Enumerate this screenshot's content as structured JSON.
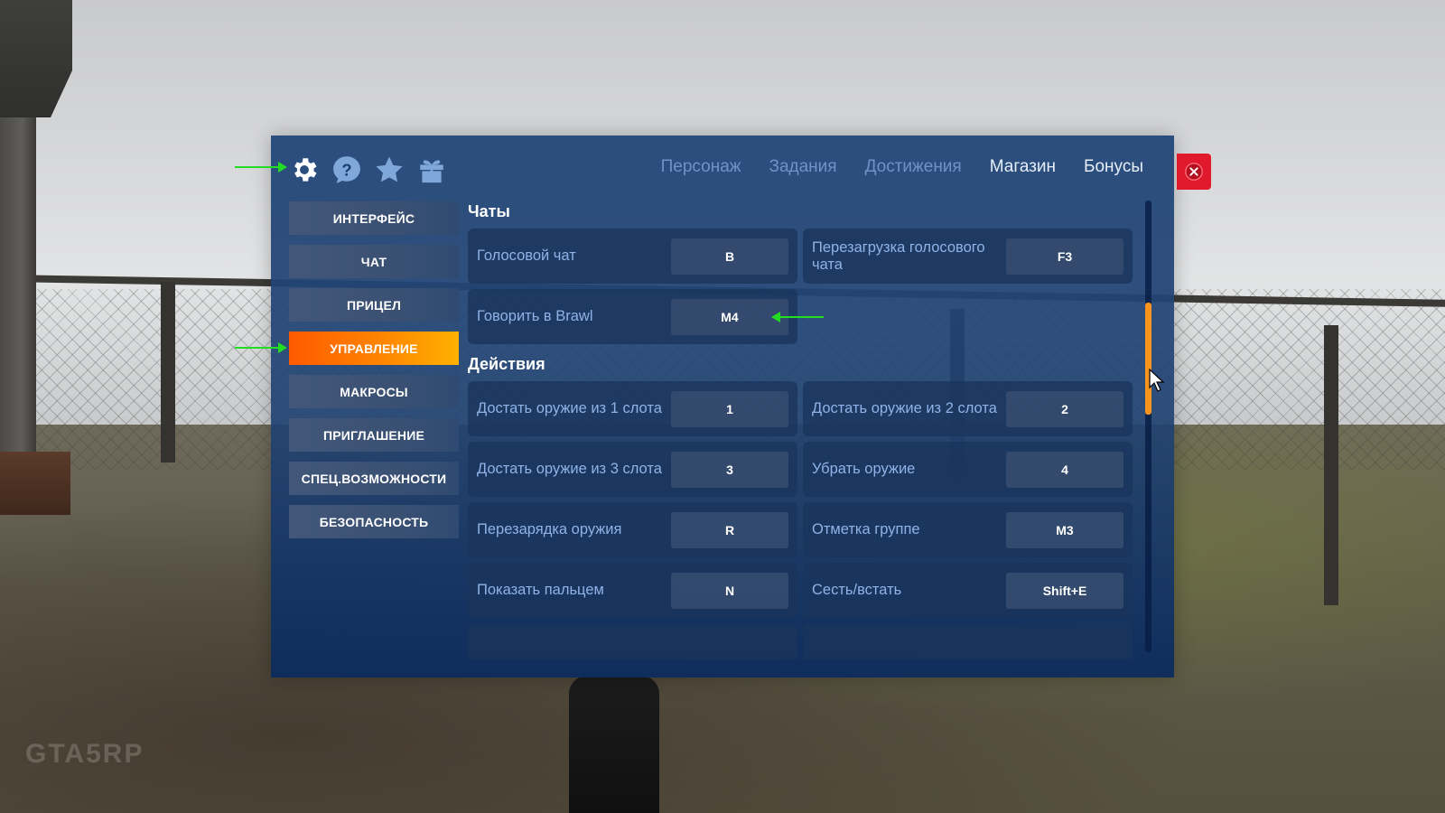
{
  "top_icons": [
    {
      "name": "settings",
      "icon": "gear-icon"
    },
    {
      "name": "help",
      "icon": "question-icon"
    },
    {
      "name": "favorites",
      "icon": "star-icon"
    },
    {
      "name": "gifts",
      "icon": "gift-icon"
    }
  ],
  "nav": {
    "character": "Персонаж",
    "tasks": "Задания",
    "achievements": "Достижения",
    "shop": "Магазин",
    "bonuses": "Бонусы"
  },
  "sidebar": {
    "items": [
      {
        "label": "ИНТЕРФЕЙС"
      },
      {
        "label": "ЧАТ"
      },
      {
        "label": "ПРИЦЕЛ"
      },
      {
        "label": "УПРАВЛЕНИЕ",
        "active": true
      },
      {
        "label": "МАКРОСЫ"
      },
      {
        "label": "ПРИГЛАШЕНИЕ"
      },
      {
        "label": "СПЕЦ.ВОЗМОЖНОСТИ"
      },
      {
        "label": "БЕЗОПАСНОСТЬ"
      }
    ]
  },
  "sections": {
    "chats": {
      "title": "Чаты",
      "rows": [
        {
          "label": "Голосовой чат",
          "key": "B"
        },
        {
          "label": "Перезагрузка голосового чата",
          "key": "F3"
        },
        {
          "label": "Говорить в Brawl",
          "key": "M4"
        }
      ]
    },
    "actions": {
      "title": "Действия",
      "rows": [
        {
          "label": "Достать оружие из 1 слота",
          "key": "1"
        },
        {
          "label": "Достать оружие из 2 слота",
          "key": "2"
        },
        {
          "label": "Достать оружие из 3 слота",
          "key": "3"
        },
        {
          "label": "Убрать оружие",
          "key": "4"
        },
        {
          "label": "Перезарядка оружия",
          "key": "R"
        },
        {
          "label": "Отметка группе",
          "key": "M3"
        },
        {
          "label": "Показать пальцем",
          "key": "N"
        },
        {
          "label": "Сесть/встать",
          "key": "Shift+E"
        }
      ]
    }
  },
  "scroll": {
    "position": 0.3
  },
  "colors": {
    "accent_orange": "#ff7a00",
    "close_red": "#e0192d",
    "annotation_green": "#22dd22"
  },
  "watermark": "GTA5RP"
}
